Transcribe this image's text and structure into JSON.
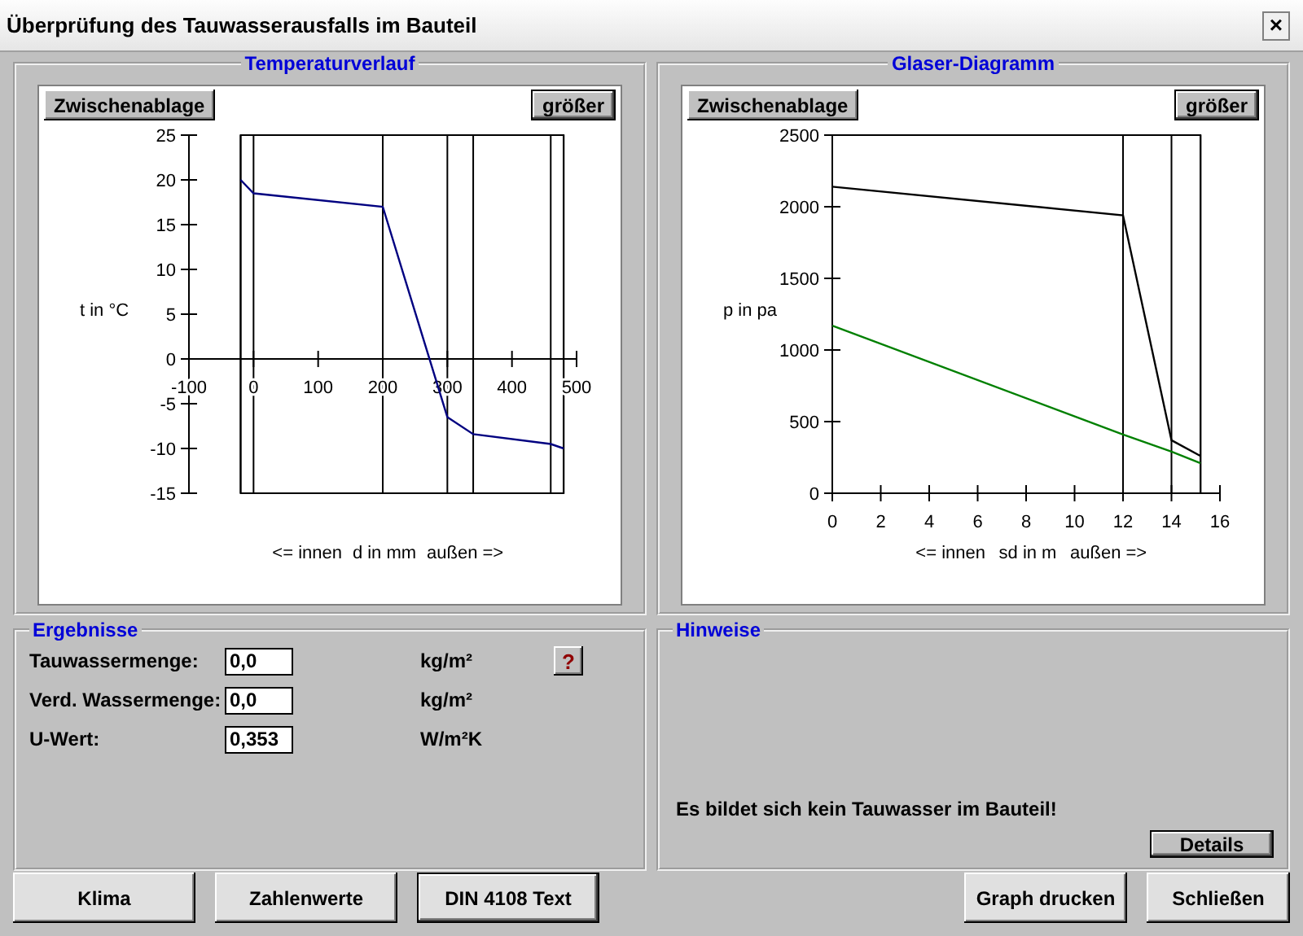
{
  "window": {
    "title": "Überprüfung des Tauwasserausfalls im Bauteil",
    "close": "×"
  },
  "charts": [
    {
      "buttons": [
        {
          "label": "Zwischenablage",
          "default": false
        },
        {
          "label": "größer",
          "default": true
        }
      ],
      "inner_label": "<= innen",
      "outer_label": "außen =>",
      "chart_data": {
        "type": "line",
        "grid": true,
        "title": "Temperaturverlauf",
        "xlabel": "d in mm",
        "ylabel": "t in °C",
        "x": [
          -20,
          0,
          200,
          300,
          340,
          460,
          480
        ],
        "series": [
          {
            "color": "#000080",
            "values": [
              20,
              18.5,
              17,
              -6.5,
              -8.4,
              -9.5,
              -10
            ]
          }
        ],
        "xlim": [
          -100,
          500
        ],
        "ylim": [
          -15,
          25
        ],
        "xticks": [
          -100,
          0,
          100,
          200,
          300,
          400,
          500
        ],
        "yticks": [
          -15,
          -10,
          -5,
          0,
          5,
          10,
          15,
          20,
          25
        ]
      }
    },
    {
      "buttons": [
        {
          "label": "Zwischenablage",
          "default": false
        },
        {
          "label": "größer",
          "default": true
        }
      ],
      "inner_label": "<= innen",
      "outer_label": "außen =>",
      "chart_data": {
        "type": "line",
        "grid": true,
        "title": "Glaser-Diagramm",
        "xlabel": "sd in m",
        "ylabel": "p in pa",
        "x": [
          0,
          12,
          14,
          15.2
        ],
        "series": [
          {
            "color": "#000000",
            "values": [
              2140,
              1940,
              370,
              260
            ]
          },
          {
            "color": "#008000",
            "values": [
              1170,
              410,
              290,
              210
            ]
          }
        ],
        "xlim": [
          0,
          16
        ],
        "ylim": [
          0,
          2500
        ],
        "xticks": [
          0,
          2,
          4,
          6,
          8,
          10,
          12,
          14,
          16
        ],
        "yticks": [
          0,
          500,
          1000,
          1500,
          2000,
          2500
        ]
      }
    }
  ],
  "results": {
    "title": "Ergebnisse",
    "help_button": "?",
    "rows": [
      {
        "label": "Tauwassermenge:",
        "value": "0,0",
        "unit": "kg/m²"
      },
      {
        "label": "Verd. Wassermenge:",
        "value": "0,0",
        "unit": "kg/m²"
      },
      {
        "label": "U-Wert:",
        "value": "0,353",
        "unit": "W/m²K"
      }
    ]
  },
  "notes": {
    "title": "Hinweise",
    "message": "Es bildet sich kein Tauwasser im Bauteil!",
    "details_button": "Details"
  },
  "buttons": [
    {
      "label": "Klima",
      "default": false
    },
    {
      "label": "Zahlenwerte",
      "default": false
    },
    {
      "label": "DIN 4108 Text",
      "default": true
    },
    {
      "label": "Graph drucken",
      "default": false
    },
    {
      "label": "Schließen",
      "default": false
    }
  ]
}
